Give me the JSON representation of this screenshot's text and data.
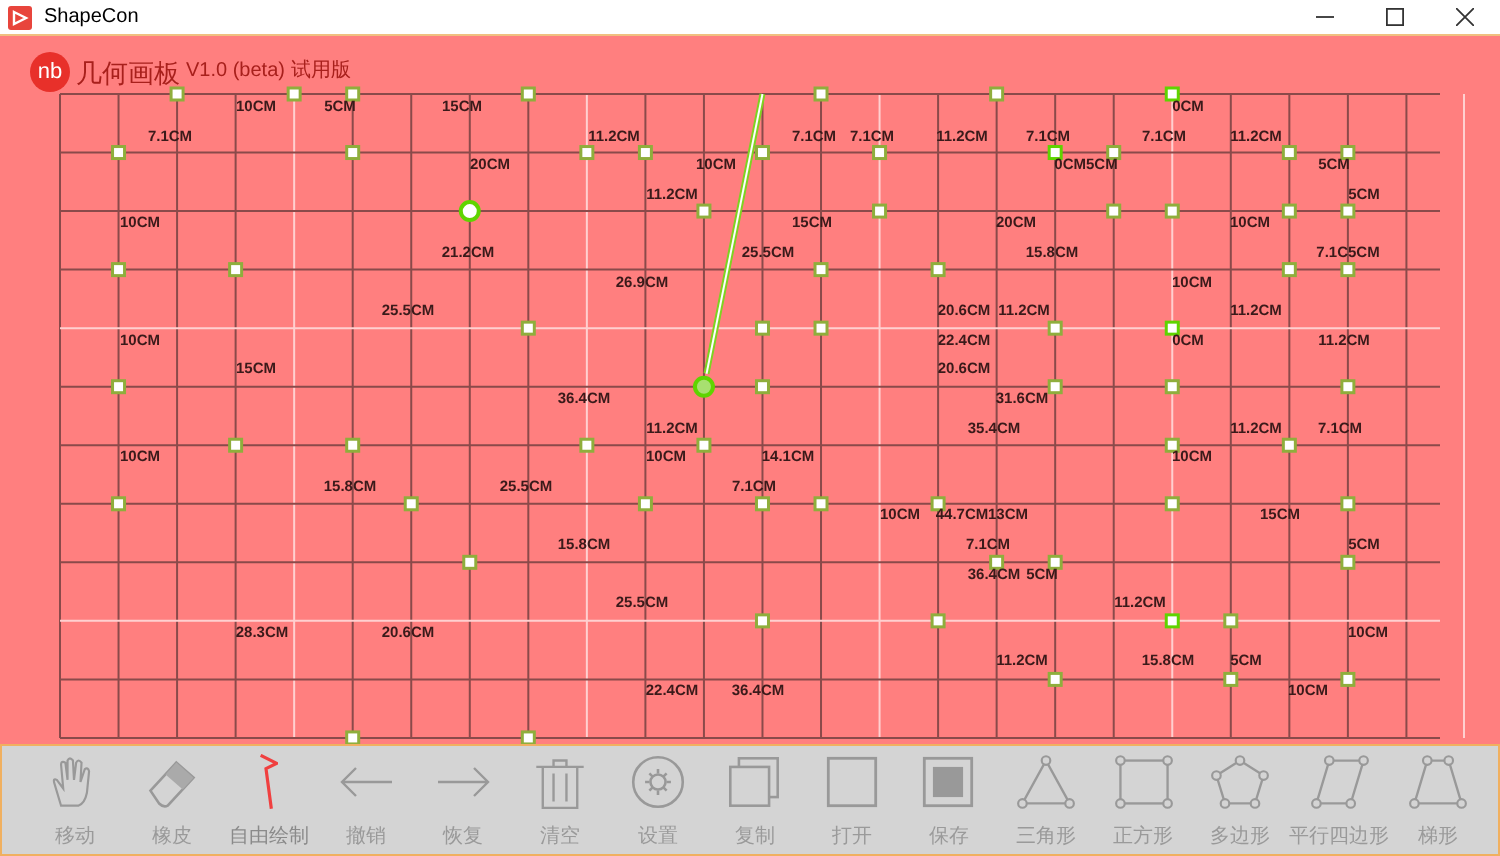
{
  "window": {
    "title": "ShapeCon"
  },
  "logo": {
    "mark": "nb",
    "name": "几何画板",
    "version": "V1.0 (beta) 试用版"
  },
  "canvas": {
    "labels": [
      "10CM",
      "5CM",
      "15CM",
      "0CM",
      "7.1CM",
      "11.2CM",
      "7.1CM",
      "7.1CM",
      "11.2CM",
      "7.1CM",
      "7.1CM",
      "11.2CM",
      "20CM",
      "10CM",
      "0CM5CM",
      "5CM",
      "11.2CM",
      "5CM",
      "10CM",
      "15CM",
      "20CM",
      "10CM",
      "21.2CM",
      "25.5CM",
      "15.8CM",
      "7.1C5CM",
      "26.9CM",
      "10CM",
      "25.5CM",
      "20.6CM",
      "11.2CM",
      "11.2CM",
      "10CM",
      "22.4CM",
      "0CM",
      "11.2CM",
      "15CM",
      "20.6CM",
      "36.4CM",
      "31.6CM",
      "11.2CM",
      "35.4CM",
      "11.2CM",
      "7.1CM",
      "10CM",
      "10CM",
      "14.1CM",
      "10CM",
      "15.8CM",
      "25.5CM",
      "7.1CM",
      "10CM",
      "44.7CM",
      "13CM",
      "15CM",
      "15.8CM",
      "7.1CM",
      "5CM",
      "36.4CM",
      "5CM",
      "25.5CM",
      "11.2CM",
      "28.3CM",
      "20.6CM",
      "10CM",
      "11.2CM",
      "15.8CM",
      "5CM",
      "22.4CM",
      "36.4CM",
      "10CM"
    ]
  },
  "toolbar": [
    {
      "kind": "hand",
      "label": "移动",
      "selected": false
    },
    {
      "kind": "eraser",
      "label": "橡皮",
      "selected": false
    },
    {
      "kind": "pen",
      "label": "自由绘制",
      "selected": true
    },
    {
      "kind": "undo",
      "label": "撤销",
      "selected": false
    },
    {
      "kind": "redo",
      "label": "恢复",
      "selected": false
    },
    {
      "kind": "trash",
      "label": "清空",
      "selected": false
    },
    {
      "kind": "gear",
      "label": "设置",
      "selected": false
    },
    {
      "kind": "copy",
      "label": "复制",
      "selected": false
    },
    {
      "kind": "open",
      "label": "打开",
      "selected": false
    },
    {
      "kind": "save",
      "label": "保存",
      "selected": false
    },
    {
      "kind": "triangle",
      "label": "三角形",
      "selected": false
    },
    {
      "kind": "square",
      "label": "正方形",
      "selected": false
    },
    {
      "kind": "pentagon",
      "label": "多边形",
      "selected": false
    },
    {
      "kind": "parallelogram",
      "label": "平行四边形",
      "selected": false
    },
    {
      "kind": "trapezoid",
      "label": "梯形",
      "selected": false
    }
  ]
}
